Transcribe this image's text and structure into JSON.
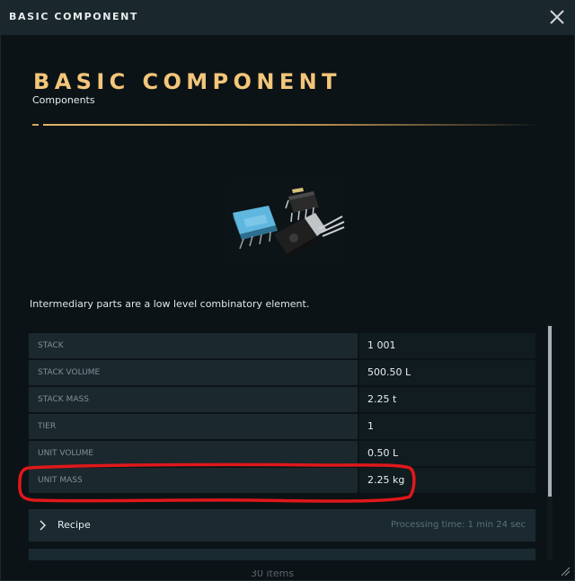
{
  "window": {
    "title": "BASIC COMPONENT",
    "close_icon": "close-icon"
  },
  "item": {
    "name": "BASIC COMPONENT",
    "category": "Components",
    "image_icon": "electronic-components-icon",
    "description": "Intermediary parts are a low level combinatory element."
  },
  "stats": [
    {
      "label": "STACK",
      "value": "1 001"
    },
    {
      "label": "STACK VOLUME",
      "value": "500.50 L"
    },
    {
      "label": "STACK MASS",
      "value": "2.25 t"
    },
    {
      "label": "TIER",
      "value": "1"
    },
    {
      "label": "UNIT VOLUME",
      "value": "0.50 L"
    },
    {
      "label": "UNIT MASS",
      "value": "2.25 kg"
    }
  ],
  "recipe": {
    "label": "Recipe",
    "processing_time": "Processing time: 1 min 24 sec"
  },
  "footer": {
    "items_count": "30 items"
  },
  "colors": {
    "accent_gold": "#f3c67a",
    "highlight_red": "#e0181b",
    "titlebar_bg": "#1a272c"
  }
}
